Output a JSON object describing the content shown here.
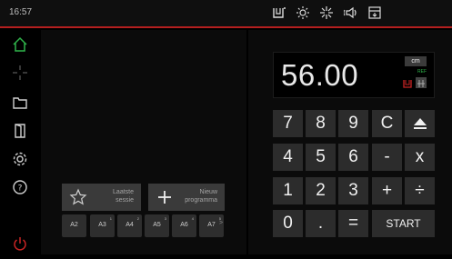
{
  "statusbar": {
    "time": "16:57",
    "icons": [
      "saw-lamp-icon",
      "sun-icon",
      "sparkle-icon",
      "speaker-icon",
      "machine-icon"
    ]
  },
  "sidebar": {
    "items": [
      "home-icon",
      "crosshair-icon",
      "folder-icon",
      "door-icon",
      "settings-gear-icon",
      "help-icon",
      "power-icon"
    ],
    "colors": {
      "active": "#2fb24a",
      "power": "#c82424",
      "default": "#cfcfcf"
    }
  },
  "actions": {
    "last_session": {
      "line1": "Laatste",
      "line2": "sessie"
    },
    "new_program": {
      "line1": "Nieuw",
      "line2": "programma"
    }
  },
  "presets": [
    {
      "label": "A2",
      "sup": ""
    },
    {
      "label": "A3",
      "sup": "1"
    },
    {
      "label": "A4",
      "sup": "2"
    },
    {
      "label": "A5",
      "sup": "3"
    },
    {
      "label": "A6",
      "sup": "4"
    },
    {
      "label": "A7",
      "sup": "5"
    }
  ],
  "presets_more": ">",
  "calculator": {
    "display_value": "56.00",
    "unit": "cm",
    "ref_label": "REF",
    "keys": {
      "k7": "7",
      "k8": "8",
      "k9": "9",
      "kC": "C",
      "k4": "4",
      "k5": "5",
      "k6": "6",
      "kminus": "-",
      "kmul": "x",
      "k1": "1",
      "k2": "2",
      "k3": "3",
      "kplus": "+",
      "kdiv": "÷",
      "k0": "0",
      "kdot": ".",
      "keq": "=",
      "start": "START"
    }
  },
  "colors": {
    "accent_red": "#b51f1f",
    "ref_green": "#2fb24a"
  }
}
